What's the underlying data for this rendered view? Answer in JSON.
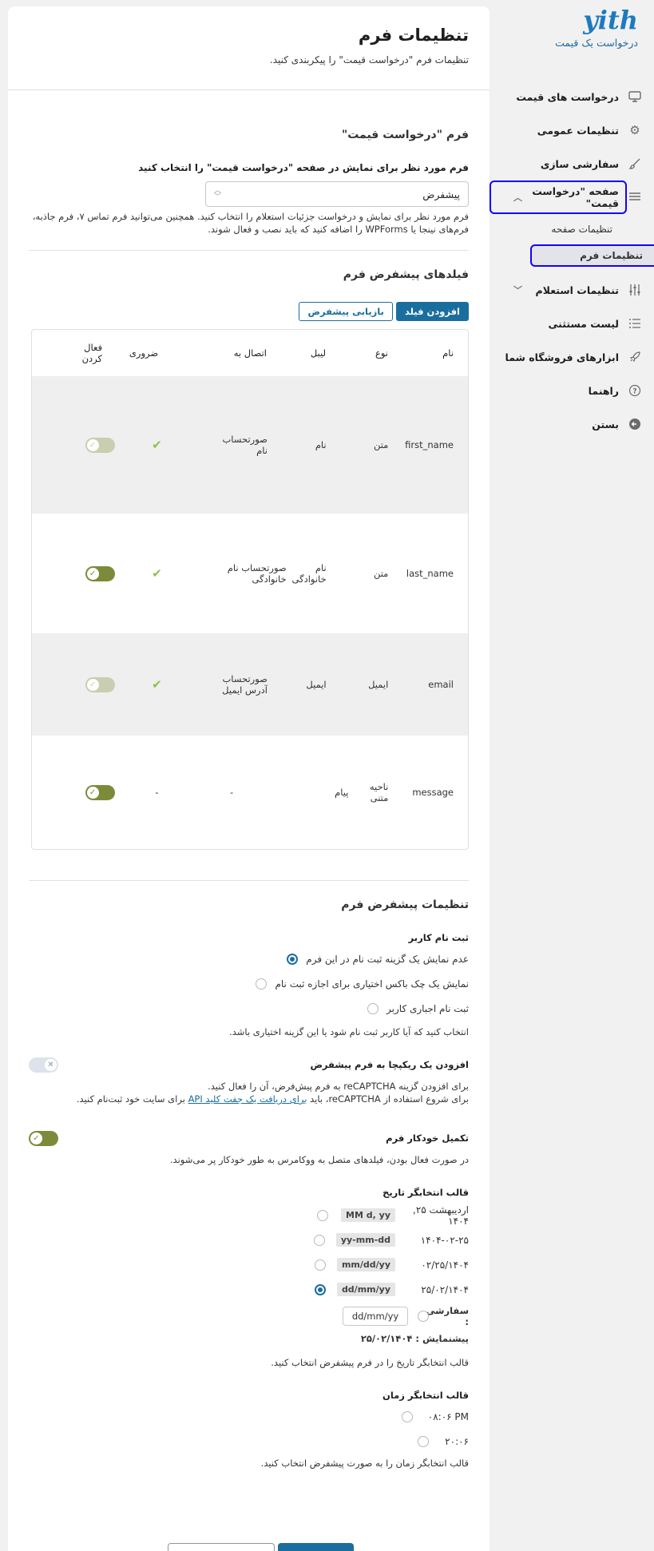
{
  "sidebar": {
    "brand_logo": "yith",
    "brand_sub": "درخواست یک قیمت",
    "items": [
      {
        "label": "درخواست های قیمت",
        "icon": "monitor-icon"
      },
      {
        "label": "تنظیمات عمومی",
        "icon": "gear-icon"
      },
      {
        "label": "سفارشی سازی",
        "icon": "brush-icon"
      },
      {
        "label": "صفحه \"درخواست قیمت\"",
        "icon": "list-icon"
      },
      {
        "label": "تنظیمات استعلام",
        "icon": "sliders-icon"
      },
      {
        "label": "لیست مستثنی",
        "icon": "list-bullets-icon"
      },
      {
        "label": "ابزارهای فروشگاه شما",
        "icon": "rocket-icon"
      },
      {
        "label": "راهنما",
        "icon": "question-icon"
      },
      {
        "label": "بستن",
        "icon": "arrow-left-circle-icon"
      }
    ],
    "submenu": [
      {
        "label": "تنظیمات صفحه"
      },
      {
        "label": "تنظیمات فرم"
      }
    ]
  },
  "header": {
    "title": "تنظیمات فرم",
    "desc": "تنظیمات فرم \"درخواست قیمت\" را پیکربندی کنید."
  },
  "form_section": {
    "title": "فرم \"درخواست قیمت\"",
    "label": "فرم مورد نظر برای نمایش در صفحه \"درخواست قیمت\" را انتخاب کنید",
    "select_value": "پیشفرض",
    "help_line1": "فرم مورد نظر برای نمایش و درخواست جزئیات استعلام را انتخاب کنید. همچنین می‌توانید فرم تماس ۷، فرم جاذبه،",
    "help_line2": "فرم‌های نینجا یا WPForms را اضافه کنید که باید نصب و فعال شوند."
  },
  "fields_section": {
    "title": "فیلدهای پیشفرض فرم",
    "add_button": "افزودن فیلد",
    "restore_button": "بازیابی پیشفرض",
    "columns": {
      "name": "نام",
      "type": "نوع",
      "label": "لیبل",
      "connect": "اتصال به",
      "required": "ضروری",
      "active": "فعال کردن"
    },
    "rows": [
      {
        "name": "first_name",
        "type": "متن",
        "label": "نام",
        "connect": "صورتحساب نام",
        "required": "✔",
        "active": true
      },
      {
        "name": "last_name",
        "type": "متن",
        "label": "نام خانوادگی",
        "connect": "صورتحساب نام خانوادگی",
        "required": "✔",
        "active": true
      },
      {
        "name": "email",
        "type": "ایمیل",
        "label": "ایمیل",
        "connect": "صورتحساب آدرس ایمیل",
        "required": "✔",
        "active": true
      },
      {
        "name": "message",
        "type": "ناحیه متنی",
        "label": "پیام",
        "connect": "-",
        "required": "-",
        "active": true
      }
    ]
  },
  "defaults_section": {
    "title": "تنظیمات پیشفرض فرم",
    "registration": {
      "label": "ثبت نام کاربر",
      "options": [
        "عدم نمایش یک گزینه ثبت نام در این فرم",
        "نمایش یک چک باکس اختیاری برای اجازه ثبت نام",
        "ثبت نام اجباری کاربر"
      ],
      "selected": 0,
      "help": "انتخاب کنید که آیا کاربر ثبت نام شود یا این گزینه اختیاری باشد."
    },
    "recaptcha": {
      "label": "افزودن یک ریکپچا به فرم پیشفرض",
      "help1": "برای افزودن گزینه reCAPTCHA به فرم پیش‌فرض، آن را فعال کنید.",
      "help2_pre": "برای شروع استفاده از reCAPTCHA، باید",
      "help2_link": "برای دریافت یک جفت کلید API",
      "help2_post": "برای سایت خود ثبت‌نام کنید.",
      "enabled": false
    },
    "autocomplete": {
      "label": "تکمیل خودکار فرم",
      "help": "در صورت فعال بودن، فیلدهای متصل به ووکامرس به طور خودکار پر می‌شوند.",
      "enabled": true
    },
    "date_format": {
      "label": "قالب انتخابگر تاریخ",
      "options": [
        {
          "display": "اردیبهشت ۲۵, ۱۴۰۴",
          "code": "MM d, yy"
        },
        {
          "display": "۱۴۰۴-۰۲-۲۵",
          "code": "yy-mm-dd"
        },
        {
          "display": "۰۲/۲۵/۱۴۰۴",
          "code": "mm/dd/yy"
        },
        {
          "display": "۲۵/۰۲/۱۴۰۴",
          "code": "dd/mm/yy"
        }
      ],
      "selected": 3,
      "custom_label": "سفارشی :",
      "custom_value": "dd/mm/yy",
      "preview": "پیشنمایش : ۲۵/۰۲/۱۴۰۴",
      "help": "قالب انتخابگر تاریخ را در فرم پیشفرض انتخاب کنید."
    },
    "time_format": {
      "label": "قالب انتخابگر زمان",
      "options": [
        "۰۸:۰۶ PM",
        "۲۰:۰۶"
      ],
      "help": "قالب انتخابگر زمان را به صورت پیشفرض انتخاب کنید."
    }
  },
  "colors": {
    "accent": "#1a6e9e",
    "highlight": "#1400ff",
    "toggle_on": "#7c8b3a",
    "check": "#8bc34a"
  }
}
